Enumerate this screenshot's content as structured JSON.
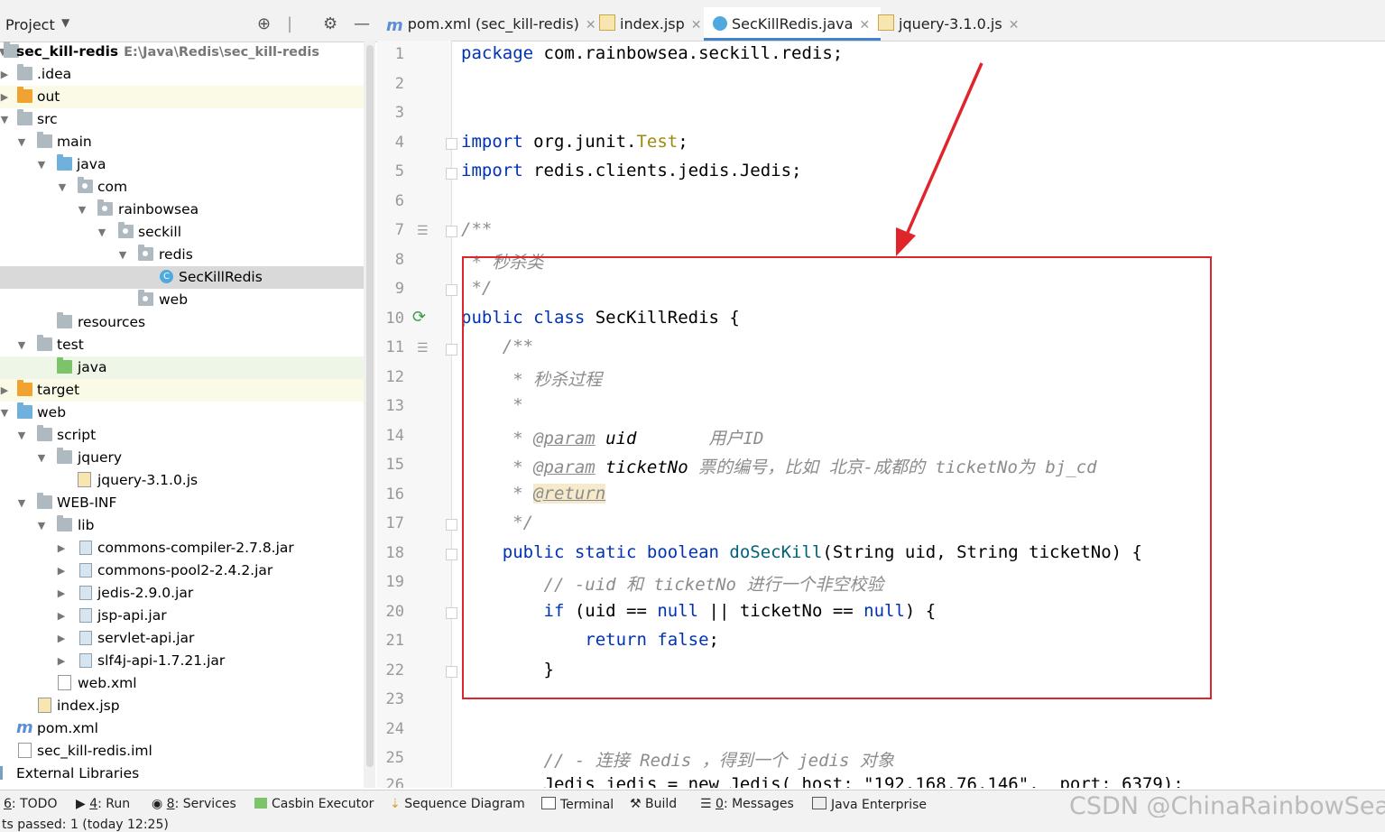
{
  "project_panel": {
    "title": "Project",
    "tree": [
      {
        "label": "sec_kill-redis",
        "path": "E:\\Java\\Redis\\sec_kill-redis",
        "bold": true
      },
      {
        "label": ".idea"
      },
      {
        "label": "out"
      },
      {
        "label": "src"
      },
      {
        "label": "main"
      },
      {
        "label": "java"
      },
      {
        "label": "com"
      },
      {
        "label": "rainbowsea"
      },
      {
        "label": "seckill"
      },
      {
        "label": "redis"
      },
      {
        "label": "SecKillRedis"
      },
      {
        "label": "web"
      },
      {
        "label": "resources"
      },
      {
        "label": "test"
      },
      {
        "label": "java"
      },
      {
        "label": "target"
      },
      {
        "label": "web"
      },
      {
        "label": "script"
      },
      {
        "label": "jquery"
      },
      {
        "label": "jquery-3.1.0.js"
      },
      {
        "label": "WEB-INF"
      },
      {
        "label": "lib"
      },
      {
        "label": "commons-compiler-2.7.8.jar"
      },
      {
        "label": "commons-pool2-2.4.2.jar"
      },
      {
        "label": "jedis-2.9.0.jar"
      },
      {
        "label": "jsp-api.jar"
      },
      {
        "label": "servlet-api.jar"
      },
      {
        "label": "slf4j-api-1.7.21.jar"
      },
      {
        "label": "web.xml"
      },
      {
        "label": "index.jsp"
      },
      {
        "label": "pom.xml"
      },
      {
        "label": "sec_kill-redis.iml"
      },
      {
        "label": "External Libraries"
      }
    ]
  },
  "tabs": [
    {
      "label": "pom.xml (sec_kill-redis)"
    },
    {
      "label": "index.jsp"
    },
    {
      "label": "SecKillRedis.java",
      "active": true
    },
    {
      "label": "jquery-3.1.0.js"
    }
  ],
  "editor": {
    "line_numbers": [
      "1",
      "2",
      "3",
      "4",
      "5",
      "6",
      "7",
      "8",
      "9",
      "10",
      "11",
      "12",
      "13",
      "14",
      "15",
      "16",
      "17",
      "18",
      "19",
      "20",
      "21",
      "22",
      "23",
      "24",
      "25",
      "26"
    ],
    "code": {
      "l1_kw": "package",
      "l1_rest": " com.rainbowsea.seckill.redis;",
      "l4_kw": "import",
      "l4_pkg": " org.junit.",
      "l4_ann": "Test",
      "l4_end": ";",
      "l5_kw": "import",
      "l5_rest": " redis.clients.jedis.Jedis;",
      "l7": "/**",
      "l8": " * 秒杀类",
      "l9": " */",
      "l10_kw": "public class",
      "l10_rest": " SecKillRedis {",
      "l11": "    /**",
      "l12": "     * 秒杀过程",
      "l13": "     *",
      "l14_star": "     * ",
      "l14_tag": "@param",
      "l14_p": " uid",
      "l14_desc": "       用户ID",
      "l15_star": "     * ",
      "l15_tag": "@param",
      "l15_p": " ticketNo",
      "l15_desc": " 票的编号，比如 北京-成都的 ticketNo为 bj_cd",
      "l16_star": "     * ",
      "l16_tag": "@return",
      "l17": "     */",
      "l18_kw": "    public static boolean",
      "l18_meth": " doSecKill",
      "l18_rest": "(String uid, String ticketNo) {",
      "l19": "        // -uid 和 ticketNo 进行一个非空校验",
      "l20_kw": "        if",
      "l20_a": " (uid == ",
      "l20_null1": "null",
      "l20_b": " || ticketNo == ",
      "l20_null2": "null",
      "l20_c": ") {",
      "l21_kw": "            return false",
      "l21_end": ";",
      "l22": "        }",
      "l25": "        // - 连接 Redis ，得到一个 jedis 对象",
      "l26": "        Jedis jedis = new Jedis( host: \"192.168.76.146\",  port: 6379);"
    }
  },
  "tool_windows": [
    {
      "num": "6",
      "label": ": TODO"
    },
    {
      "num": "4",
      "label": ": Run"
    },
    {
      "num": "8",
      "label": ": Services"
    },
    {
      "num": "",
      "label": "Casbin Executor"
    },
    {
      "num": "",
      "label": "Sequence Diagram"
    },
    {
      "num": "",
      "label": "Terminal"
    },
    {
      "num": "",
      "label": "Build"
    },
    {
      "num": "0",
      "label": ": Messages"
    },
    {
      "num": "",
      "label": "Java Enterprise"
    }
  ],
  "status_text": "ts passed: 1 (today 12:25)",
  "watermark": "CSDN @ChinaRainbowSea",
  "colors": {
    "keyword": "#0033b3",
    "comment": "#8c8c8c",
    "annotation": "#9e880d",
    "highlight_box": "#e0242b",
    "arrow": "#e0242b",
    "tab_underline": "#4083c9"
  }
}
